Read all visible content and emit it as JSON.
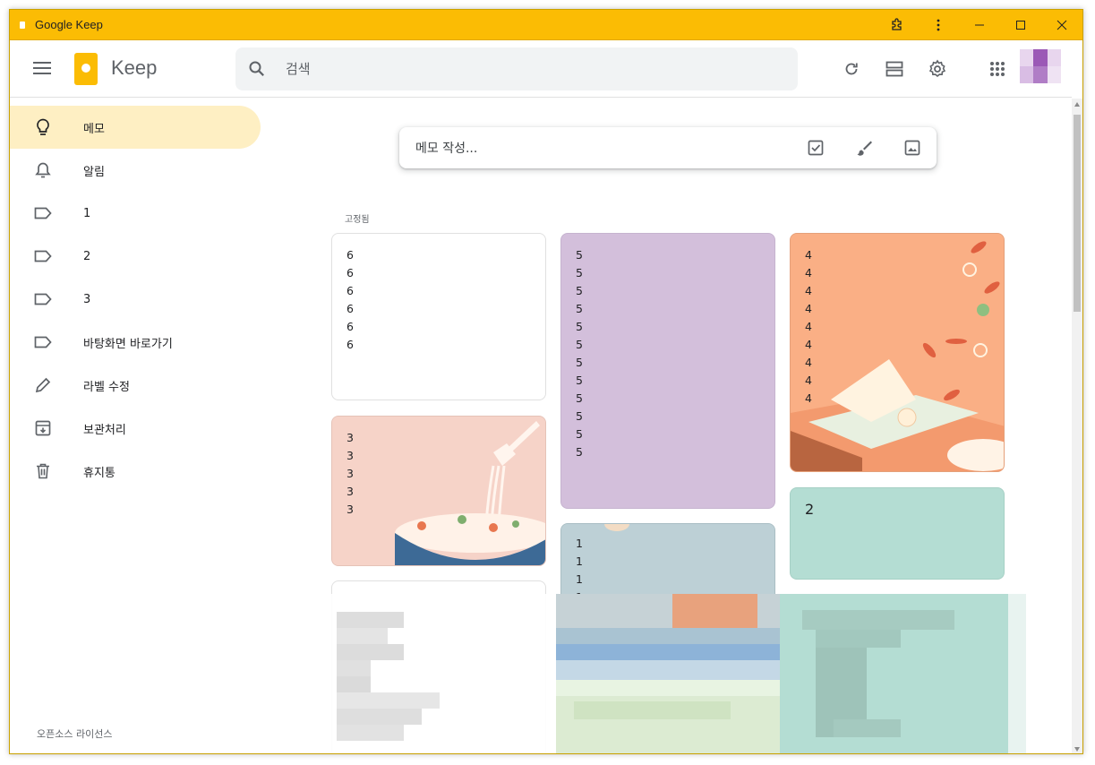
{
  "window": {
    "title": "Google Keep",
    "controls": [
      "extension",
      "menu",
      "minimize",
      "maximize",
      "close"
    ]
  },
  "header": {
    "app_name": "Keep",
    "search_placeholder": "검색",
    "icons": [
      "refresh-icon",
      "list-view-icon",
      "settings-icon",
      "apps-icon"
    ]
  },
  "sidebar": {
    "items": [
      {
        "label": "메모",
        "icon": "lightbulb-icon",
        "active": true
      },
      {
        "label": "알림",
        "icon": "bell-icon",
        "active": false
      },
      {
        "label": "1",
        "icon": "label-icon",
        "active": false
      },
      {
        "label": "2",
        "icon": "label-icon",
        "active": false
      },
      {
        "label": "3",
        "icon": "label-icon",
        "active": false
      },
      {
        "label": "바탕화면 바로가기",
        "icon": "label-icon",
        "active": false
      },
      {
        "label": "라벨 수정",
        "icon": "pencil-icon",
        "active": false
      },
      {
        "label": "보관처리",
        "icon": "archive-icon",
        "active": false
      },
      {
        "label": "휴지통",
        "icon": "trash-icon",
        "active": false
      }
    ],
    "footer": "오픈소스 라이선스"
  },
  "composer": {
    "placeholder": "메모 작성...",
    "buttons": [
      "checkbox-icon",
      "brush-icon",
      "image-icon"
    ]
  },
  "pinned_label": "고정됨",
  "notes": [
    {
      "id": "n6",
      "lines": [
        "6",
        "6",
        "6",
        "6",
        "6",
        "6"
      ],
      "color": "#ffffff"
    },
    {
      "id": "n5",
      "lines": [
        "5",
        "5",
        "5",
        "5",
        "5",
        "5",
        "5",
        "5",
        "5",
        "5",
        "5",
        "5"
      ],
      "color": "#d3bfdb"
    },
    {
      "id": "n4",
      "lines": [
        "4",
        "4",
        "4",
        "4",
        "4",
        "4",
        "4",
        "4",
        "4"
      ],
      "color": "#faaf85"
    },
    {
      "id": "n3",
      "lines": [
        "3",
        "3",
        "3",
        "3",
        "3"
      ],
      "color": "#f6d3c8"
    },
    {
      "id": "n2",
      "lines": [
        "2"
      ],
      "color": "#b4ddd3"
    },
    {
      "id": "n1",
      "lines": [
        "1",
        "1",
        "1",
        "1"
      ],
      "color": "#bdd0d6"
    }
  ],
  "colors": {
    "titlebar": "#fbbc04",
    "active_nav": "#feefc3",
    "search_bg": "#f1f3f4"
  }
}
